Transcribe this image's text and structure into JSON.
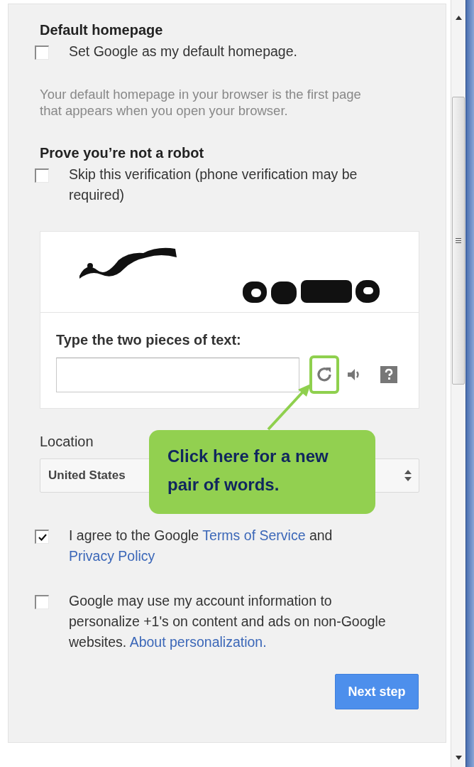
{
  "sections": [
    {
      "kind": "checkbox-group",
      "heading": "Default homepage",
      "checkbox": {
        "checked": false,
        "segments": [
          {
            "text": "Set Google as my default homepage.",
            "kind": "text"
          }
        ]
      },
      "hint": "Your default homepage in your browser is the first page that appears when you open your browser."
    },
    {
      "kind": "checkbox-group",
      "heading": "Prove you’re not a robot",
      "checkbox": {
        "checked": false,
        "segments": [
          {
            "text": "Skip this verification (phone verification may be required)",
            "kind": "text"
          }
        ]
      }
    },
    {
      "kind": "captcha",
      "prompt": "Type the two pieces of text:"
    },
    {
      "kind": "select",
      "label": "Location",
      "value": "United States"
    },
    {
      "kind": "checkbox",
      "checkbox": {
        "checked": true,
        "segments": [
          {
            "text": "I agree to the Google ",
            "kind": "text"
          },
          {
            "text": "Terms of Service",
            "kind": "link"
          },
          {
            "text": " and ",
            "kind": "text"
          },
          {
            "text": "Privacy Policy",
            "kind": "link"
          }
        ]
      }
    },
    {
      "kind": "checkbox",
      "checkbox": {
        "checked": false,
        "segments": [
          {
            "text": "Google may use my account information to personalize +1's on content and ads on non-Google websites. ",
            "kind": "text"
          },
          {
            "text": "About personalization.",
            "kind": "link"
          }
        ]
      }
    }
  ],
  "next_button": "Next step",
  "callout": {
    "text": "Click here for a new pair of words."
  }
}
